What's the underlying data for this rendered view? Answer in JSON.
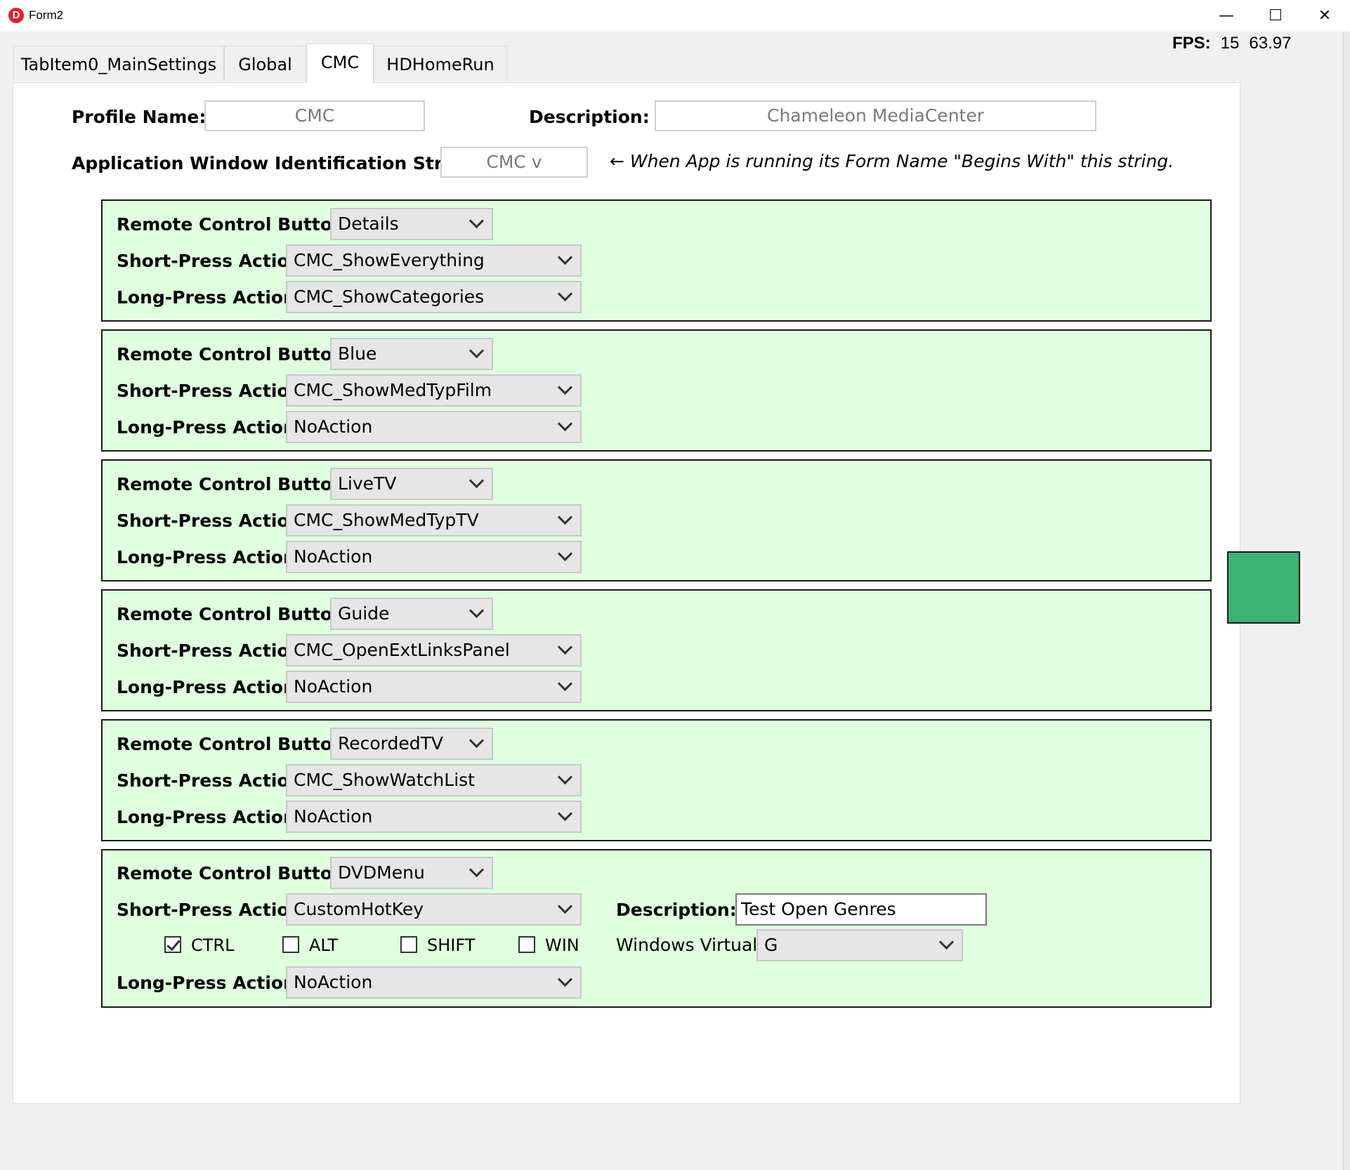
{
  "window": {
    "title": "Form2",
    "icon_glyph": "D",
    "minimize_glyph": "—",
    "maximize_glyph": "☐",
    "close_glyph": "✕"
  },
  "fps": {
    "label": "FPS:",
    "value1": "15",
    "value2": "63.97"
  },
  "tabs": [
    {
      "label": "TabItem0_MainSettings"
    },
    {
      "label": "Global"
    },
    {
      "label": "CMC",
      "active": true
    },
    {
      "label": "HDHomeRun"
    }
  ],
  "profile": {
    "name_label": "Profile Name:",
    "name_value": "CMC",
    "description_label": "Description:",
    "description_value": "Chameleon MediaCenter",
    "app_id_label": "Application Window Identification String:",
    "app_id_value": "CMC v",
    "hint": "← When App is running its Form Name \"Begins With\" this string."
  },
  "labels": {
    "remote_button": "Remote Control Button:",
    "short_press": "Short-Press Action:",
    "long_press": "Long-Press Action:",
    "description": "Description:",
    "virtual_key": "Windows Virtual Key:"
  },
  "mappings": [
    {
      "button": "Details",
      "short": "CMC_ShowEverything",
      "long": "CMC_ShowCategories"
    },
    {
      "button": "Blue",
      "short": "CMC_ShowMedTypFilm",
      "long": "NoAction"
    },
    {
      "button": "LiveTV",
      "short": "CMC_ShowMedTypTV",
      "long": "NoAction"
    },
    {
      "button": "Guide",
      "short": "CMC_OpenExtLinksPanel",
      "long": "NoAction"
    },
    {
      "button": "RecordedTV",
      "short": "CMC_ShowWatchList",
      "long": "NoAction"
    },
    {
      "button": "DVDMenu",
      "short": "CustomHotKey",
      "long": "NoAction",
      "hotkey": {
        "description": "Test Open Genres",
        "virtual_key": "G",
        "modifiers": [
          {
            "label": "CTRL",
            "checked": true
          },
          {
            "label": "ALT",
            "checked": false
          },
          {
            "label": "SHIFT",
            "checked": false
          },
          {
            "label": "WIN",
            "checked": false
          }
        ]
      }
    }
  ],
  "colors": {
    "panel_bg": "#dfffdf",
    "indicator": "#3cb371"
  }
}
